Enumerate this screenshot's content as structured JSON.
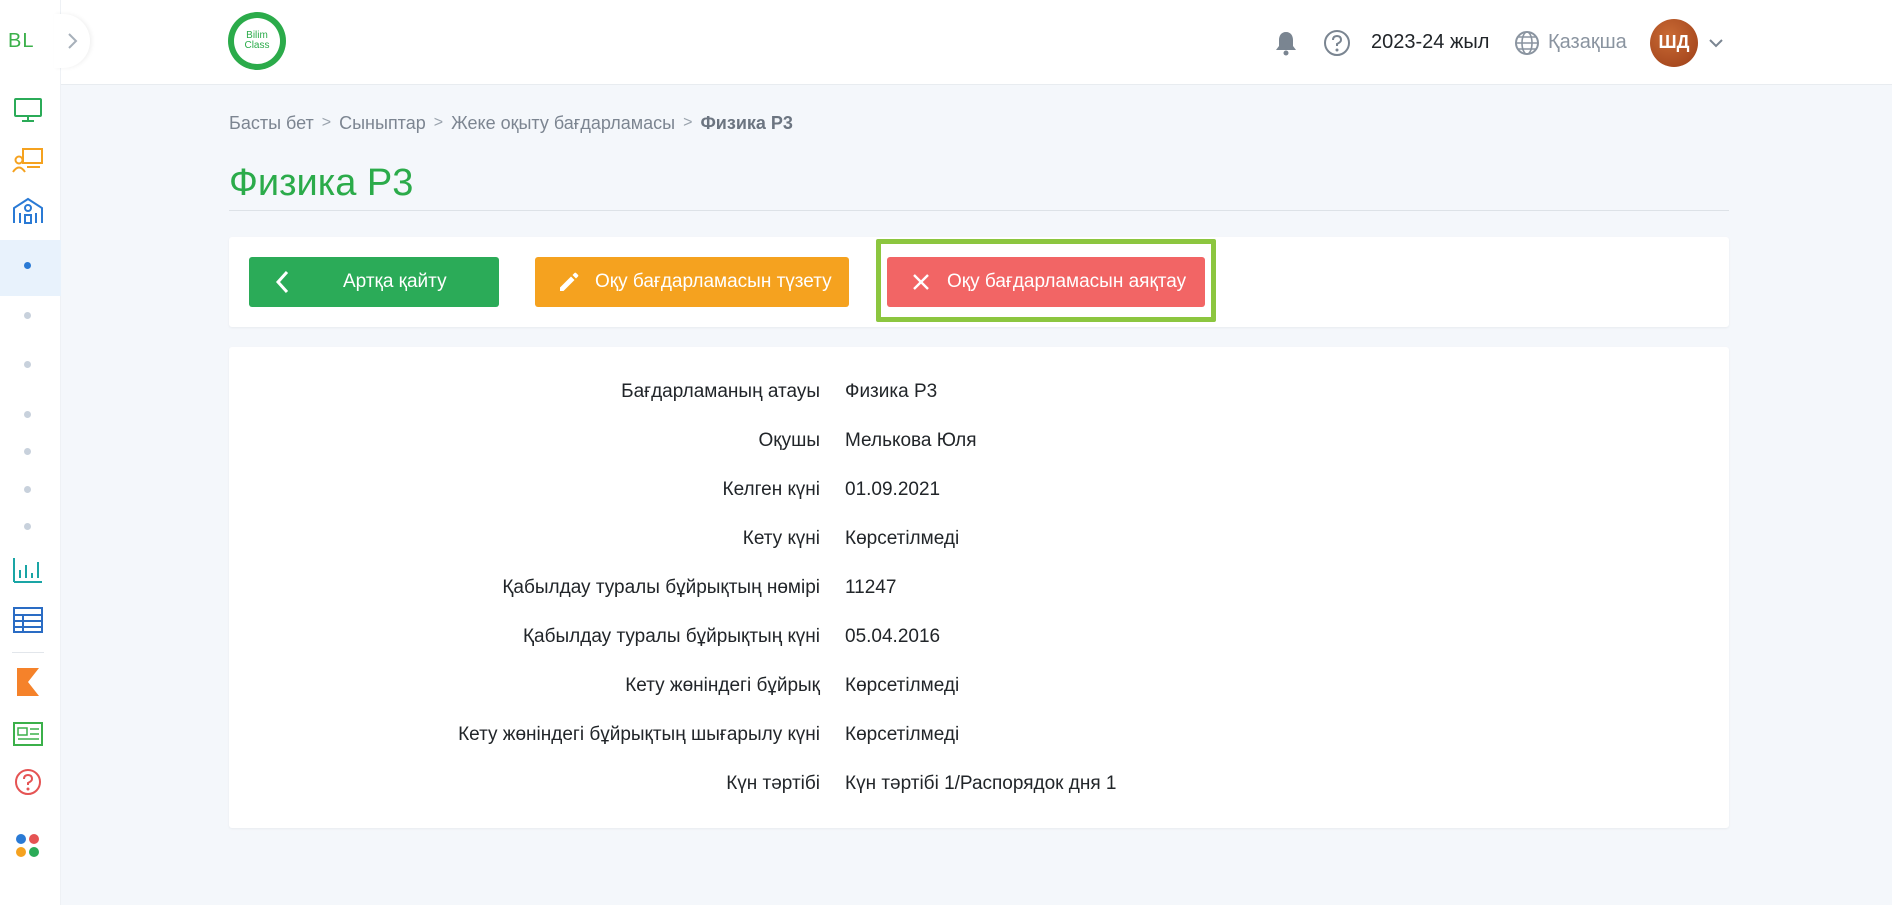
{
  "sidebar": {
    "logo": "BL",
    "items": [
      {
        "icon": "monitor-icon"
      },
      {
        "icon": "teacher-board-icon"
      },
      {
        "icon": "school-building-icon"
      },
      {
        "icon": "bar-chart-icon"
      },
      {
        "icon": "table-grid-icon"
      },
      {
        "icon": "kundelik-icon"
      },
      {
        "icon": "newspaper-icon"
      },
      {
        "icon": "help-circle-icon"
      },
      {
        "icon": "apps-dots-icon"
      }
    ]
  },
  "header": {
    "brand_line1": "Bilim",
    "brand_line2": "Class",
    "year": "2023-24 жыл",
    "language": "Қазақша",
    "avatar_initials": "ШД"
  },
  "breadcrumb": {
    "items": [
      "Басты бет",
      "Сыныптар",
      "Жеке оқыту бағдарламасы"
    ],
    "current": "Физика Р3"
  },
  "page": {
    "title": "Физика Р3"
  },
  "actions": {
    "back_label": "Артқа қайту",
    "edit_label": "Оқу бағдарламасын түзету",
    "finish_label": "Оқу бағдарламасын аяқтау"
  },
  "details": [
    {
      "label": "Бағдарламаның атауы",
      "value": "Физика Р3"
    },
    {
      "label": "Оқушы",
      "value": "Мелькова Юля"
    },
    {
      "label": "Келген күні",
      "value": "01.09.2021"
    },
    {
      "label": "Кету күні",
      "value": "Көрсетілмеді"
    },
    {
      "label": "Қабылдау туралы бұйрықтың нөмірі",
      "value": "11247"
    },
    {
      "label": "Қабылдау туралы бұйрықтың күні",
      "value": "05.04.2016"
    },
    {
      "label": "Кету жөніндегі бұйрық",
      "value": "Көрсетілмеді"
    },
    {
      "label": "Кету жөніндегі бұйрықтың шығарылу күні",
      "value": "Көрсетілмеді"
    },
    {
      "label": "Күн тәртібі",
      "value": "Күн тәртібі 1/Распорядок дня 1"
    }
  ],
  "colors": {
    "brand_green": "#2bab4a",
    "back_button": "#2bab58",
    "edit_button": "#f5a21f",
    "finish_button": "#f26565",
    "highlight_border": "#8cc63f"
  }
}
